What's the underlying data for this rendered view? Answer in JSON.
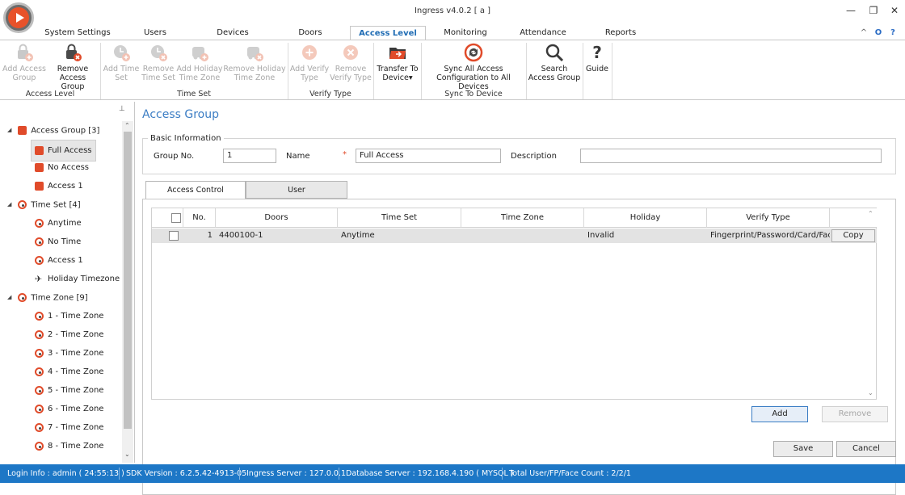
{
  "window": {
    "title": "Ingress v4.0.2 [ a ]",
    "controls": {
      "minimize": "—",
      "restore": "❐",
      "close": "✕"
    }
  },
  "menu_tabs": [
    {
      "label": "System Settings"
    },
    {
      "label": "Users"
    },
    {
      "label": "Devices"
    },
    {
      "label": "Doors"
    },
    {
      "label": "Access Level",
      "active": true
    },
    {
      "label": "Monitoring"
    },
    {
      "label": "Attendance"
    },
    {
      "label": "Reports"
    }
  ],
  "menu_right": {
    "collapse": "^",
    "office": "O",
    "help": "?"
  },
  "ribbon": {
    "add_access_group": "Add Access Group",
    "remove_access_group": "Remove Access Group",
    "access_level_group": "Access Level",
    "add_time_set": "Add Time Set",
    "remove_time_set": "Remove Time Set",
    "add_holiday_tz": "Add Holiday Time Zone",
    "remove_holiday_tz": "Remove Holiday Time Zone",
    "time_set_group": "Time Set",
    "add_verify_type": "Add Verify Type",
    "remove_verify_type": "Remove Verify Type",
    "verify_type_group": "Verify Type",
    "transfer_to_device": "Transfer To Device",
    "sync_all": "Sync All Access Configuration to All Devices",
    "sync_group": "Sync To Device",
    "search_access_group": "Search Access Group",
    "guide": "Guide"
  },
  "tree": {
    "access_group": "Access Group [3]",
    "ag_items": [
      "Full Access",
      "No Access",
      "Access 1"
    ],
    "time_set": "Time Set [4]",
    "ts_items": [
      "Anytime",
      "No Time",
      "Access 1",
      "Holiday Timezone"
    ],
    "time_zone": "Time Zone [9]",
    "tz_items": [
      "1 - Time Zone",
      "2 - Time Zone",
      "3 - Time Zone",
      "4 - Time Zone",
      "5 - Time Zone",
      "6 - Time Zone",
      "7 - Time Zone",
      "8 - Time Zone"
    ]
  },
  "main": {
    "title": "Access Group",
    "basic_info": "Basic Information",
    "group_no_label": "Group No.",
    "group_no_value": "1",
    "name_label": "Name",
    "required_mark": "*",
    "name_value": "Full Access",
    "description_label": "Description",
    "description_value": "",
    "tabs": [
      "Access Control",
      "User"
    ],
    "columns": [
      "No.",
      "Doors",
      "Time Set",
      "Time Zone",
      "Holiday",
      "Verify Type"
    ],
    "rows": [
      {
        "no": "1",
        "doors": "4400100-1",
        "time_set": "Anytime",
        "time_zone": "",
        "holiday": "Invalid",
        "verify_type": "Fingerprint/Password/Card/Face",
        "action": "Copy"
      }
    ],
    "add_button": "Add",
    "remove_button": "Remove",
    "save_button": "Save",
    "cancel_button": "Cancel"
  },
  "status": {
    "login": "Login Info : admin ( 24:55:13 )",
    "sdk": "SDK Version : 6.2.5.42-4913-05",
    "ingress_server": "Ingress Server : 127.0.0.1",
    "db_server": "Database Server : 192.168.4.190 ( MYSQL )",
    "counts": "Total User/FP/Face Count : 2/2/1"
  },
  "colors": {
    "accent": "#1f6cb4",
    "statusbar": "#1d77c6",
    "icon_red": "#e04b2a",
    "disabled": "#a8a8a8"
  }
}
